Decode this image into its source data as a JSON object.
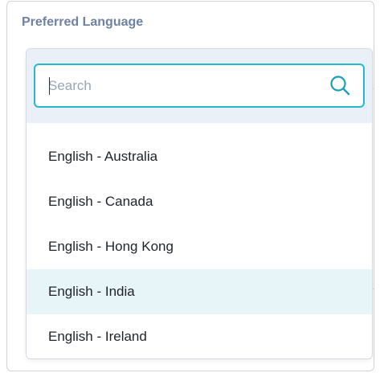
{
  "field": {
    "label": "Preferred Language"
  },
  "search": {
    "placeholder": "Search",
    "value": "",
    "icon": "search-icon"
  },
  "options": [
    {
      "label": "English - Australia",
      "highlighted": false
    },
    {
      "label": "English - Canada",
      "highlighted": false
    },
    {
      "label": "English - Hong Kong",
      "highlighted": false
    },
    {
      "label": "English - India",
      "highlighted": true
    },
    {
      "label": "English - Ireland",
      "highlighted": false
    }
  ],
  "colors": {
    "label": "#6f82a1",
    "accent": "#27b8cf",
    "search_band": "#eaf0f8",
    "highlight": "#e7f4f8",
    "text": "#1f2328"
  }
}
